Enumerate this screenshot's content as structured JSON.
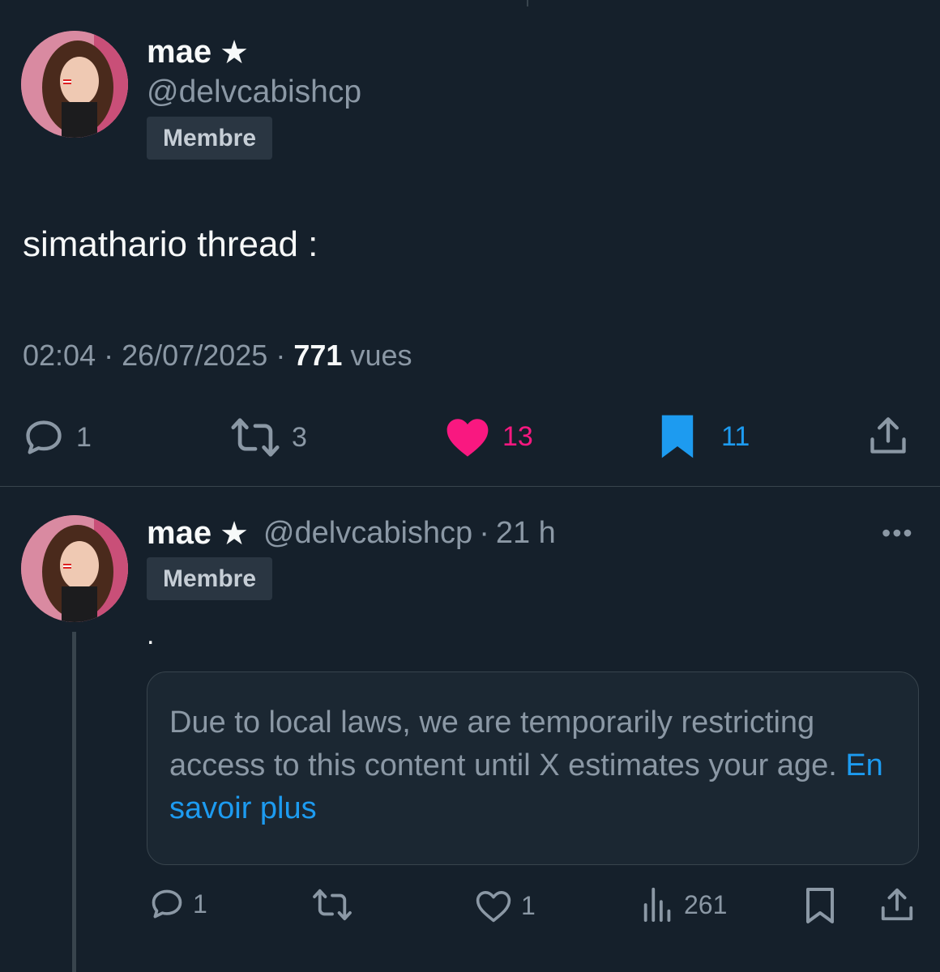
{
  "main_tweet": {
    "author": {
      "name": "mae",
      "star": "★",
      "handle": "@delvcabishcp",
      "badge": "Membre"
    },
    "text": "simathario thread :",
    "time": "02:04",
    "date": "26/07/2025",
    "views_count": "771",
    "views_label": "vues",
    "meta_separator": "·",
    "actions": {
      "reply_count": "1",
      "retweet_count": "3",
      "like_count": "13",
      "bookmark_count": "11"
    },
    "icons": [
      "reply-icon",
      "retweet-icon",
      "heart-icon",
      "bookmark-icon",
      "share-icon"
    ],
    "colors": {
      "like": "#f91880",
      "bookmark": "#1d9bf0"
    }
  },
  "reply_tweet": {
    "author": {
      "name": "mae",
      "star": "★",
      "handle": "@delvcabishcp",
      "badge": "Membre"
    },
    "separator": "·",
    "age": "21 h",
    "more": "•••",
    "text": ".",
    "notice": {
      "message": "Due to local laws, we are temporarily restricting access to this content until X estimates your age.",
      "link": "En savoir plus"
    },
    "actions": {
      "reply_count": "1",
      "like_count": "1",
      "views_count": "261"
    },
    "icons": [
      "reply-icon",
      "retweet-icon",
      "heart-outline-icon",
      "views-chart-icon",
      "bookmark-outline-icon",
      "share-icon"
    ]
  },
  "colors": {
    "background": "#15202b",
    "muted": "#8b98a5",
    "link": "#1d9bf0"
  }
}
